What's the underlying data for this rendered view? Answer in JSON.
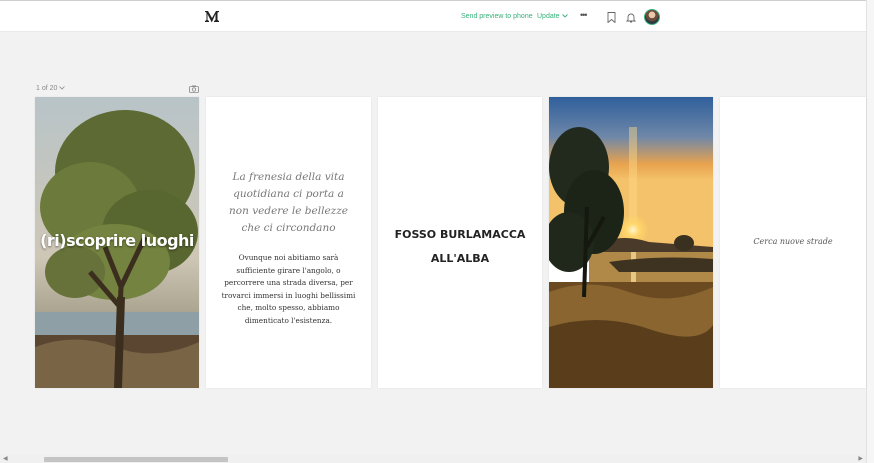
{
  "topbar": {
    "send_preview": "Send preview to phone",
    "update": "Update",
    "more": "•••",
    "icons": {
      "logo": "medium-logo-icon",
      "chevron": "chevron-down-icon",
      "bookmark": "bookmark-icon",
      "bell": "bell-icon"
    },
    "accent_color": "#3ab07b"
  },
  "pager": {
    "counter": "1 of 20",
    "camera_icon": "camera-icon"
  },
  "cards": [
    {
      "type": "image",
      "title": "(ri)scoprire luoghi"
    },
    {
      "type": "text",
      "quote": "La frenesia della vita quotidiana ci porta a non vedere le bellezze che ci circondano",
      "body": "Ovunque noi abitiamo sarà sufficiente girare l'angolo, o percorrere una strada diversa, per trovarci immersi in luoghi bellissimi che, molto spesso, abbiamo dimenticato l'esistenza."
    },
    {
      "type": "text",
      "heading_line1": "FOSSO BURLAMACCA",
      "heading_line2": "ALL'ALBA"
    },
    {
      "type": "image"
    },
    {
      "type": "text",
      "note": "Cerca nuove strade"
    }
  ]
}
